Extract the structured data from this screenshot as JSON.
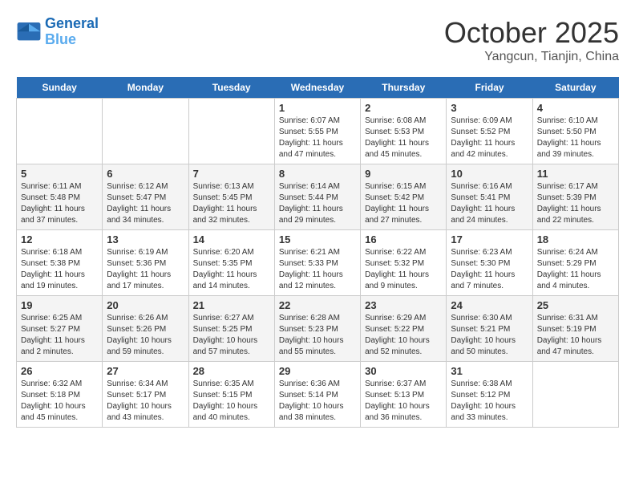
{
  "header": {
    "logo_line1": "General",
    "logo_line2": "Blue",
    "month": "October 2025",
    "location": "Yangcun, Tianjin, China"
  },
  "days_of_week": [
    "Sunday",
    "Monday",
    "Tuesday",
    "Wednesday",
    "Thursday",
    "Friday",
    "Saturday"
  ],
  "weeks": [
    [
      {
        "date": "",
        "info": ""
      },
      {
        "date": "",
        "info": ""
      },
      {
        "date": "",
        "info": ""
      },
      {
        "date": "1",
        "info": "Sunrise: 6:07 AM\nSunset: 5:55 PM\nDaylight: 11 hours and 47 minutes."
      },
      {
        "date": "2",
        "info": "Sunrise: 6:08 AM\nSunset: 5:53 PM\nDaylight: 11 hours and 45 minutes."
      },
      {
        "date": "3",
        "info": "Sunrise: 6:09 AM\nSunset: 5:52 PM\nDaylight: 11 hours and 42 minutes."
      },
      {
        "date": "4",
        "info": "Sunrise: 6:10 AM\nSunset: 5:50 PM\nDaylight: 11 hours and 39 minutes."
      }
    ],
    [
      {
        "date": "5",
        "info": "Sunrise: 6:11 AM\nSunset: 5:48 PM\nDaylight: 11 hours and 37 minutes."
      },
      {
        "date": "6",
        "info": "Sunrise: 6:12 AM\nSunset: 5:47 PM\nDaylight: 11 hours and 34 minutes."
      },
      {
        "date": "7",
        "info": "Sunrise: 6:13 AM\nSunset: 5:45 PM\nDaylight: 11 hours and 32 minutes."
      },
      {
        "date": "8",
        "info": "Sunrise: 6:14 AM\nSunset: 5:44 PM\nDaylight: 11 hours and 29 minutes."
      },
      {
        "date": "9",
        "info": "Sunrise: 6:15 AM\nSunset: 5:42 PM\nDaylight: 11 hours and 27 minutes."
      },
      {
        "date": "10",
        "info": "Sunrise: 6:16 AM\nSunset: 5:41 PM\nDaylight: 11 hours and 24 minutes."
      },
      {
        "date": "11",
        "info": "Sunrise: 6:17 AM\nSunset: 5:39 PM\nDaylight: 11 hours and 22 minutes."
      }
    ],
    [
      {
        "date": "12",
        "info": "Sunrise: 6:18 AM\nSunset: 5:38 PM\nDaylight: 11 hours and 19 minutes."
      },
      {
        "date": "13",
        "info": "Sunrise: 6:19 AM\nSunset: 5:36 PM\nDaylight: 11 hours and 17 minutes."
      },
      {
        "date": "14",
        "info": "Sunrise: 6:20 AM\nSunset: 5:35 PM\nDaylight: 11 hours and 14 minutes."
      },
      {
        "date": "15",
        "info": "Sunrise: 6:21 AM\nSunset: 5:33 PM\nDaylight: 11 hours and 12 minutes."
      },
      {
        "date": "16",
        "info": "Sunrise: 6:22 AM\nSunset: 5:32 PM\nDaylight: 11 hours and 9 minutes."
      },
      {
        "date": "17",
        "info": "Sunrise: 6:23 AM\nSunset: 5:30 PM\nDaylight: 11 hours and 7 minutes."
      },
      {
        "date": "18",
        "info": "Sunrise: 6:24 AM\nSunset: 5:29 PM\nDaylight: 11 hours and 4 minutes."
      }
    ],
    [
      {
        "date": "19",
        "info": "Sunrise: 6:25 AM\nSunset: 5:27 PM\nDaylight: 11 hours and 2 minutes."
      },
      {
        "date": "20",
        "info": "Sunrise: 6:26 AM\nSunset: 5:26 PM\nDaylight: 10 hours and 59 minutes."
      },
      {
        "date": "21",
        "info": "Sunrise: 6:27 AM\nSunset: 5:25 PM\nDaylight: 10 hours and 57 minutes."
      },
      {
        "date": "22",
        "info": "Sunrise: 6:28 AM\nSunset: 5:23 PM\nDaylight: 10 hours and 55 minutes."
      },
      {
        "date": "23",
        "info": "Sunrise: 6:29 AM\nSunset: 5:22 PM\nDaylight: 10 hours and 52 minutes."
      },
      {
        "date": "24",
        "info": "Sunrise: 6:30 AM\nSunset: 5:21 PM\nDaylight: 10 hours and 50 minutes."
      },
      {
        "date": "25",
        "info": "Sunrise: 6:31 AM\nSunset: 5:19 PM\nDaylight: 10 hours and 47 minutes."
      }
    ],
    [
      {
        "date": "26",
        "info": "Sunrise: 6:32 AM\nSunset: 5:18 PM\nDaylight: 10 hours and 45 minutes."
      },
      {
        "date": "27",
        "info": "Sunrise: 6:34 AM\nSunset: 5:17 PM\nDaylight: 10 hours and 43 minutes."
      },
      {
        "date": "28",
        "info": "Sunrise: 6:35 AM\nSunset: 5:15 PM\nDaylight: 10 hours and 40 minutes."
      },
      {
        "date": "29",
        "info": "Sunrise: 6:36 AM\nSunset: 5:14 PM\nDaylight: 10 hours and 38 minutes."
      },
      {
        "date": "30",
        "info": "Sunrise: 6:37 AM\nSunset: 5:13 PM\nDaylight: 10 hours and 36 minutes."
      },
      {
        "date": "31",
        "info": "Sunrise: 6:38 AM\nSunset: 5:12 PM\nDaylight: 10 hours and 33 minutes."
      },
      {
        "date": "",
        "info": ""
      }
    ]
  ]
}
